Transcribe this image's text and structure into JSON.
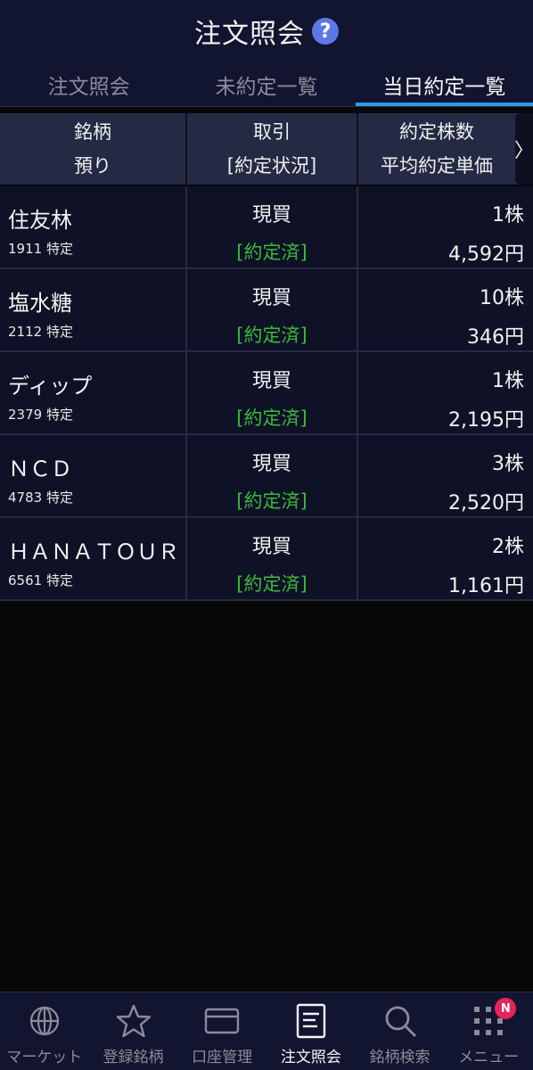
{
  "header": {
    "title": "注文照会",
    "help_icon": "?"
  },
  "tabs": [
    {
      "label": "注文照会",
      "active": false
    },
    {
      "label": "未約定一覧",
      "active": false
    },
    {
      "label": "当日約定一覧",
      "active": true
    }
  ],
  "columns": {
    "c1_line1": "銘柄",
    "c1_line2": "預り",
    "c2_line1": "取引",
    "c2_line2": "[約定状況]",
    "c3_line1": "約定株数",
    "c3_line2": "平均約定単価",
    "scroll_arrow": "〉"
  },
  "rows": [
    {
      "name": "住友林",
      "code": "1911 特定",
      "trade": "現買",
      "status": "[約定済]",
      "qty": "1株",
      "price": "4,592円"
    },
    {
      "name": "塩水糖",
      "code": "2112 特定",
      "trade": "現買",
      "status": "[約定済]",
      "qty": "10株",
      "price": "346円"
    },
    {
      "name": "ディップ",
      "code": "2379 特定",
      "trade": "現買",
      "status": "[約定済]",
      "qty": "1株",
      "price": "2,195円"
    },
    {
      "name": "ＮＣＤ",
      "code": "4783 特定",
      "trade": "現買",
      "status": "[約定済]",
      "qty": "3株",
      "price": "2,520円"
    },
    {
      "name": "ＨＡＮＡＴＯＵＲ",
      "code": "6561 特定",
      "trade": "現買",
      "status": "[約定済]",
      "qty": "2株",
      "price": "1,161円"
    }
  ],
  "bottom_nav": [
    {
      "label": "マーケット",
      "icon": "globe-icon",
      "active": false
    },
    {
      "label": "登録銘柄",
      "icon": "star-icon",
      "active": false
    },
    {
      "label": "口座管理",
      "icon": "card-icon",
      "active": false
    },
    {
      "label": "注文照会",
      "icon": "document-icon",
      "active": true
    },
    {
      "label": "銘柄検索",
      "icon": "search-icon",
      "active": false
    },
    {
      "label": "メニュー",
      "icon": "grid-menu-icon",
      "active": false,
      "badge": "N"
    }
  ],
  "colors": {
    "header_bg": "#121530",
    "accent": "#2e9ae6",
    "status_green": "#3cb83a",
    "badge": "#e5245a",
    "help_icon": "#5a78e8"
  }
}
